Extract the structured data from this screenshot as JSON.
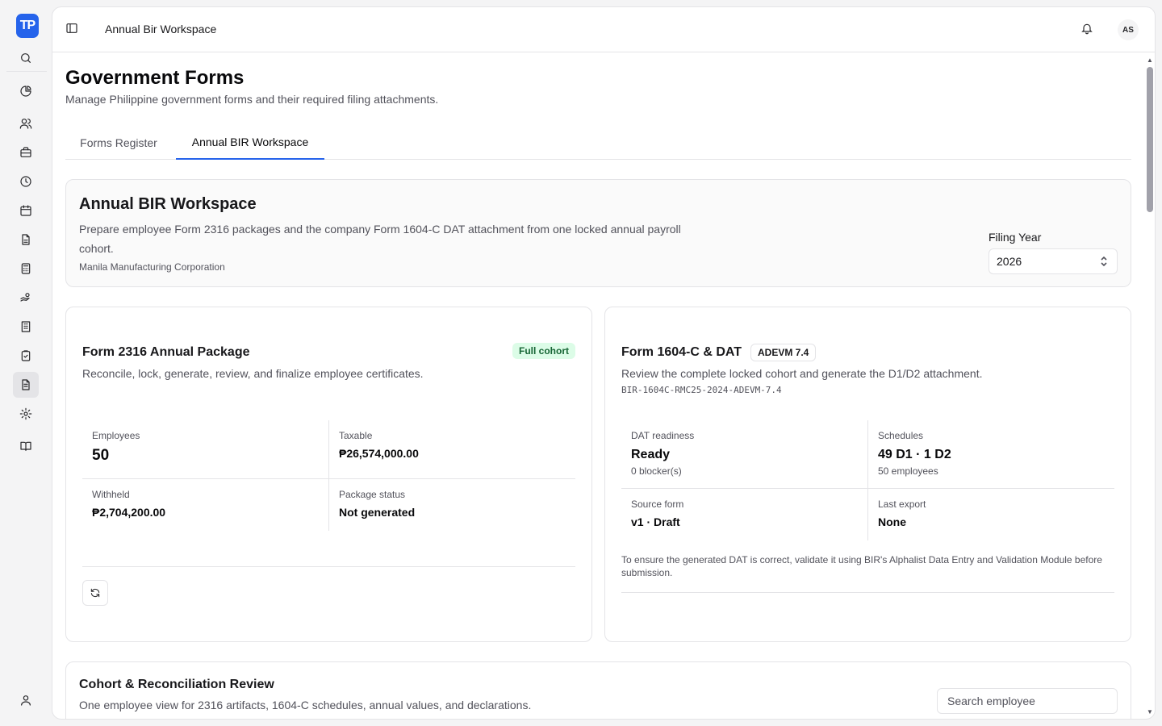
{
  "app": {
    "logo_text": "TP",
    "brand_color": "#2563eb"
  },
  "sidebar": {
    "icons": [
      "search-icon",
      "chart-pie-icon",
      "users-icon",
      "briefcase-icon",
      "clock-icon",
      "calendar-icon",
      "file-text-icon",
      "calculator-icon",
      "hand-coins-icon",
      "building-icon",
      "clipboard-check-icon",
      "forms-icon",
      "settings-icon",
      "book-open-icon",
      "user-icon"
    ],
    "active": "forms-icon"
  },
  "topbar": {
    "breadcrumb": "Annual Bir Workspace",
    "avatar_initials": "AS"
  },
  "page": {
    "title": "Government Forms",
    "subtitle": "Manage Philippine government forms and their required filing attachments."
  },
  "tabs": [
    {
      "label": "Forms Register",
      "active": false
    },
    {
      "label": "Annual BIR Workspace",
      "active": true
    }
  ],
  "hero": {
    "title": "Annual BIR Workspace",
    "description": "Prepare employee Form 2316 packages and the company Form 1604-C DAT attachment from one locked annual payroll cohort.",
    "organization": "Manila Manufacturing Corporation",
    "filing_year_label": "Filing Year",
    "filing_year_value": "2026"
  },
  "form2316": {
    "title": "Form 2316 Annual Package",
    "badge": "Full cohort",
    "description": "Reconcile, lock, generate, review, and finalize employee certificates.",
    "stats": {
      "employees_label": "Employees",
      "employees_value": "50",
      "taxable_label": "Taxable",
      "taxable_value": "₱26,574,000.00",
      "withheld_label": "Withheld",
      "withheld_value": "₱2,704,200.00",
      "status_label": "Package status",
      "status_value": "Not generated"
    }
  },
  "form1604": {
    "title": "Form 1604-C & DAT",
    "badge": "ADEVM 7.4",
    "description": "Review the complete locked cohort and generate the D1/D2 attachment.",
    "reference": "BIR-1604C-RMC25-2024-ADEVM-7.4",
    "stats": {
      "readiness_label": "DAT readiness",
      "readiness_value": "Ready",
      "readiness_note": "0 blocker(s)",
      "schedules_label": "Schedules",
      "schedules_value": "49 D1 · 1 D2",
      "schedules_note": "50 employees",
      "source_label": "Source form",
      "source_value": "v1 · Draft",
      "export_label": "Last export",
      "export_value": "None"
    },
    "note": "To ensure the generated DAT is correct, validate it using BIR's Alphalist Data Entry and Validation Module before submission."
  },
  "cohort": {
    "title": "Cohort & Reconciliation Review",
    "description": "One employee view for 2316 artifacts, 1604-C schedules, annual values, and declarations.",
    "search_placeholder": "Search employee"
  }
}
